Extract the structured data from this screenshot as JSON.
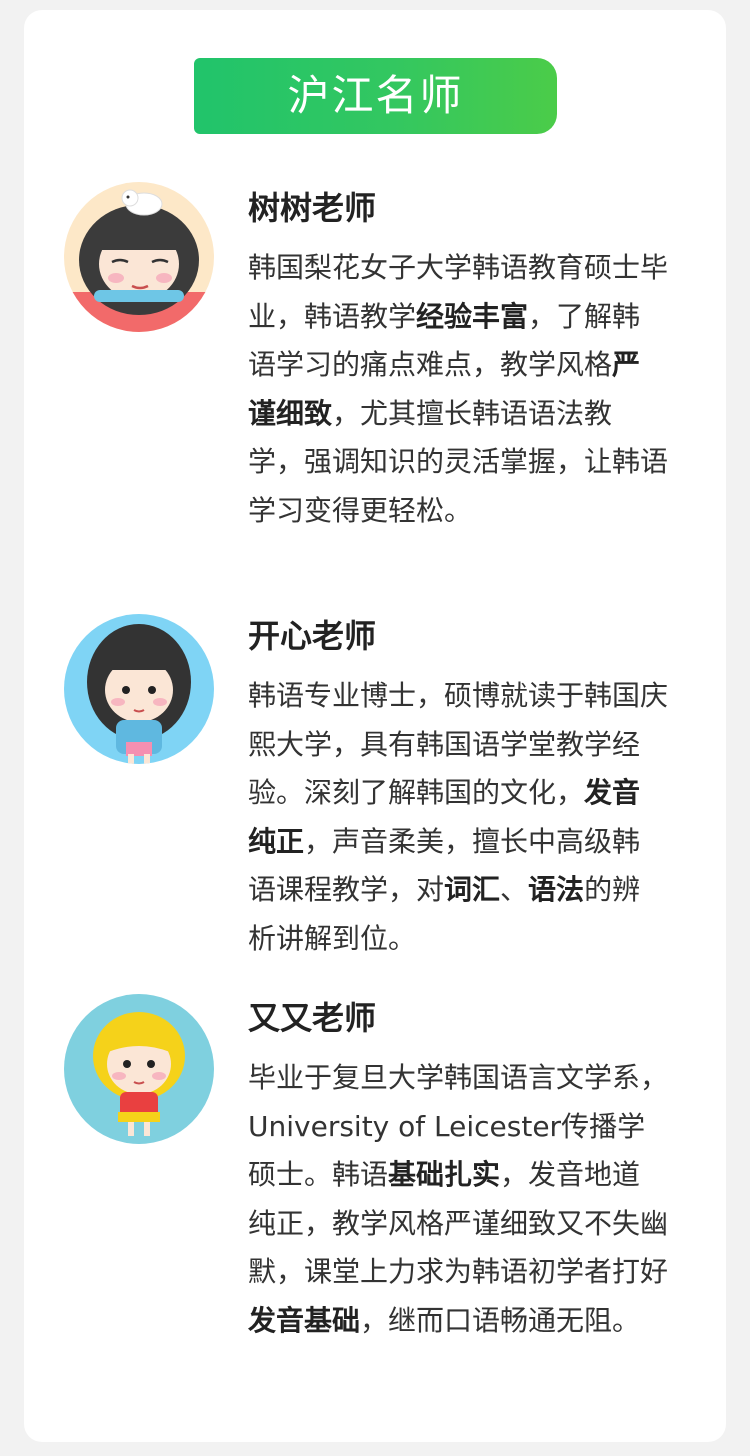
{
  "header": {
    "title": "沪江名师"
  },
  "teachers": [
    {
      "name": "树树老师",
      "avatar_icon": "girl-with-dog-avatar",
      "avatar_bg": "#fde8c8",
      "desc": [
        {
          "text": "韩国梨花女子大学韩语教育硕士毕业，韩语教学",
          "bold": false
        },
        {
          "text": "经验丰富",
          "bold": true
        },
        {
          "text": "，了解韩语学习的痛点难点，教学风格",
          "bold": false
        },
        {
          "text": "严谨细致",
          "bold": true
        },
        {
          "text": "，尤其擅长韩语语法教学，强调知识的灵活掌握，让韩语学习变得更轻松。",
          "bold": false
        }
      ]
    },
    {
      "name": "开心老师",
      "avatar_icon": "girl-thinking-avatar",
      "avatar_bg": "#7fd4f5",
      "desc": [
        {
          "text": "韩语专业博士，硕博就读于韩国庆熙大学，具有韩国语学堂教学经验。深刻了解韩国的文化，",
          "bold": false
        },
        {
          "text": "发音纯正",
          "bold": true
        },
        {
          "text": "，声音柔美，擅长中高级韩语课程教学，对",
          "bold": false
        },
        {
          "text": "词汇",
          "bold": true
        },
        {
          "text": "、",
          "bold": false
        },
        {
          "text": "语法",
          "bold": true
        },
        {
          "text": "的辨析讲解到位。",
          "bold": false
        }
      ]
    },
    {
      "name": "又又老师",
      "avatar_icon": "blonde-girl-avatar",
      "avatar_bg": "#7fd0df",
      "desc": [
        {
          "text": "毕业于复旦大学韩国语言文学系，University of Leicester传播学硕士。韩语",
          "bold": false
        },
        {
          "text": "基础扎实",
          "bold": true
        },
        {
          "text": "，发音地道纯正，教学风格严谨细致又不失幽默，课堂上力求为韩语初学者打好",
          "bold": false
        },
        {
          "text": "发音基础",
          "bold": true
        },
        {
          "text": "，继而口语畅通无阻。",
          "bold": false
        }
      ]
    }
  ]
}
